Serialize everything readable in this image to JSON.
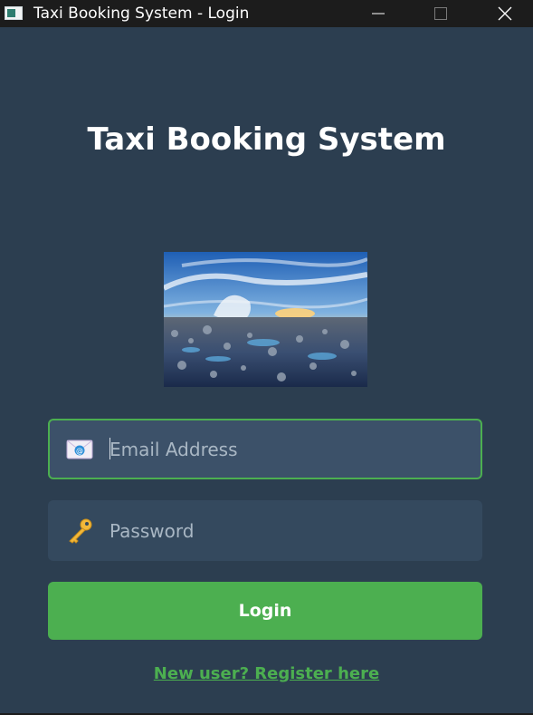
{
  "window": {
    "title": "Taxi Booking System - Login"
  },
  "header": {
    "heading": "Taxi Booking System"
  },
  "banner": {
    "icon": "seascape-photo"
  },
  "form": {
    "email": {
      "placeholder": "Email Address",
      "value": "",
      "icon": "envelope-icon",
      "focused": true
    },
    "password": {
      "placeholder": "Password",
      "value": "",
      "icon": "key-icon"
    },
    "login_label": "Login",
    "register_label": "New user? Register here"
  },
  "colors": {
    "background": "#2c3e50",
    "input_background": "#34495e",
    "input_focused_background": "#3c5169",
    "accent": "#4caf50",
    "titlebar": "#1c1c1c"
  }
}
